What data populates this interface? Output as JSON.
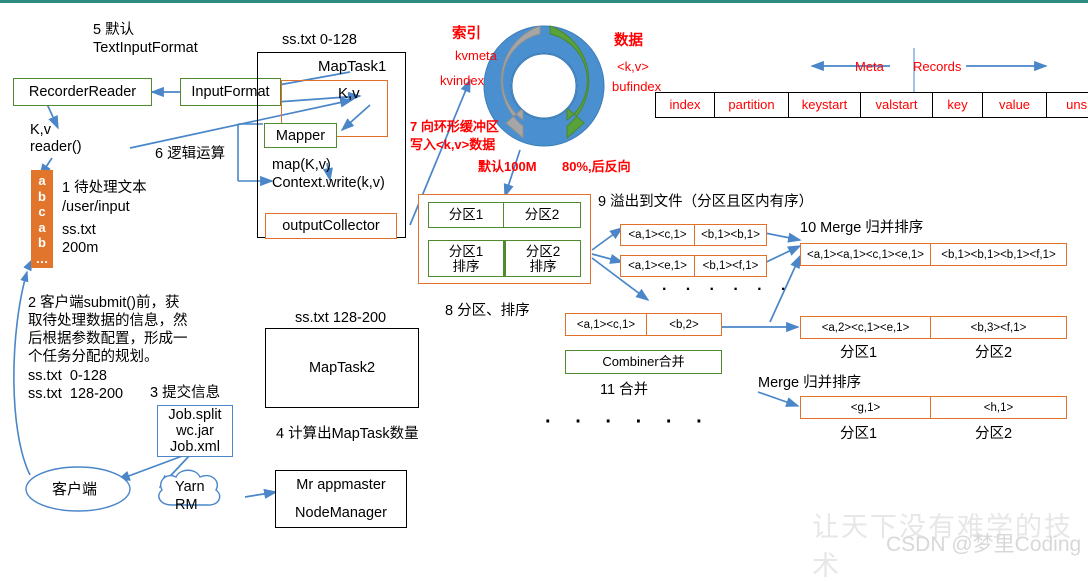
{
  "meta": {
    "watermark_line1": "让天下没有难学的技术",
    "watermark_line2": "CSDN @梦里Coding"
  },
  "colors": {
    "green_border": "#4f8a2f",
    "orange_border": "#e0702a",
    "blue_arrow": "#4a86c8",
    "red_text": "#ff0000",
    "orange_fill": "#e1752c",
    "ring_blue": "#4a90d0",
    "ring_green": "#59a13a",
    "ring_gray": "#a6a6a6",
    "top_bar": "#2d8b80"
  },
  "left_section": {
    "step5_label_line1": "5 默认",
    "step5_label_line2": "TextInputFormat",
    "recorder_reader": "RecorderReader",
    "input_format": "InputFormat",
    "kv_reader_line1": "K,v",
    "kv_reader_line2": "reader()",
    "letters_column": [
      "a",
      "b",
      "c",
      "a",
      "b",
      "…"
    ],
    "step1_title": "1 待处理文本",
    "step1_path": "/user/input",
    "step1_file": "ss.txt",
    "step1_size": "200m",
    "step2_text_lines": [
      "2 客户端submit()前，获",
      "取待处理数据的信息，然",
      "后根据参数配置，形成一",
      "个任务分配的规划。"
    ],
    "step2_split1": "ss.txt  0-128",
    "step2_split2": "ss.txt  128-200",
    "step3_label": "3 提交信息",
    "job_box_lines": [
      "Job.split",
      "wc.jar",
      "Job.xml"
    ],
    "client_label": "客户端",
    "yarn_label_line1": "Yarn",
    "yarn_label_line2": "RM",
    "step4_label": "4 计算出MapTask数量",
    "appmaster_line1": "Mr appmaster",
    "appmaster_line2": "NodeManager"
  },
  "maptask1": {
    "header_above": "ss.txt 0-128",
    "title": "MapTask1",
    "kv": "K,v",
    "mapper": "Mapper",
    "step6_label": "6 逻辑运算",
    "map_call_line1": "map(K,v)",
    "map_call_line2": "Context.write(k,v)",
    "output_collector": "outputCollector"
  },
  "maptask2": {
    "header_above": "ss.txt 128-200",
    "title": "MapTask2"
  },
  "ring_buffer": {
    "index_label": "索引",
    "kvmeta": "kvmeta",
    "kvindex": "kvindex",
    "data_label": "数据",
    "kv_pair": "<k,v>",
    "bufindex": "bufindex",
    "step7_line1": "7 向环形缓冲区",
    "step7_line2": "写入<k,v>数据",
    "default_size": "默认100M",
    "threshold": "80%,后反向"
  },
  "meta_records": {
    "meta_label": "Meta",
    "records_label": "Records",
    "cells": [
      "index",
      "partition",
      "keystart",
      "valstart",
      "key",
      "value",
      "unsued"
    ]
  },
  "partition_sort": {
    "step8_label": "8 分区、排序",
    "row1": [
      "分区1",
      "分区2"
    ],
    "row2_line1": [
      "分区1",
      "分区2"
    ],
    "row2_line2": [
      "排序",
      "排序"
    ]
  },
  "spill": {
    "step9_label": "9 溢出到文件（分区且区内有序）",
    "file1": [
      "<a,1><c,1>",
      "<b,1><b,1>"
    ],
    "file2": [
      "<a,1><e,1>",
      "<b,1><f,1>"
    ],
    "file3": [
      "<a,1><c,1>",
      "<b,2>"
    ],
    "dots": "·  ·  ·   ·  ·  ·",
    "combiner_label": "Combiner合并",
    "step11_label": "11 合并",
    "bottom_dots": "·  ·  ·   ·  ·  ·"
  },
  "merge": {
    "step10_label": "10 Merge 归并排序",
    "merged_row": [
      "<a,1><a,1><c,1><e,1>",
      "<b,1><b,1><b,1><f,1>"
    ],
    "result1_row": [
      "<a,2><c,1><e,1>",
      "<b,3><f,1>"
    ],
    "result1_labels": [
      "分区1",
      "分区2"
    ],
    "merge2_label": "Merge 归并排序",
    "result2_row": [
      "<g,1>",
      "<h,1>"
    ],
    "result2_labels": [
      "分区1",
      "分区2"
    ]
  }
}
